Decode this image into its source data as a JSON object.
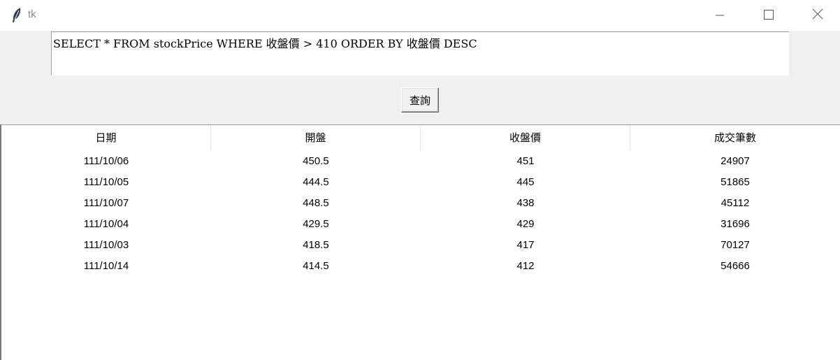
{
  "window": {
    "title": "tk"
  },
  "query": {
    "text": "SELECT * FROM stockPrice WHERE 收盤價 > 410 ORDER BY 收盤價 DESC",
    "button_label": "查詢"
  },
  "table": {
    "columns": [
      "日期",
      "開盤",
      "收盤價",
      "成交筆數"
    ],
    "rows": [
      [
        "111/10/06",
        "450.5",
        "451",
        "24907"
      ],
      [
        "111/10/05",
        "444.5",
        "445",
        "51865"
      ],
      [
        "111/10/07",
        "448.5",
        "438",
        "45112"
      ],
      [
        "111/10/04",
        "429.5",
        "429",
        "31696"
      ],
      [
        "111/10/03",
        "418.5",
        "417",
        "70127"
      ],
      [
        "111/10/14",
        "414.5",
        "412",
        "54666"
      ]
    ]
  },
  "icons": {
    "app": "feather-icon",
    "minimize": "minimize-icon",
    "maximize": "maximize-icon",
    "close": "close-icon"
  }
}
